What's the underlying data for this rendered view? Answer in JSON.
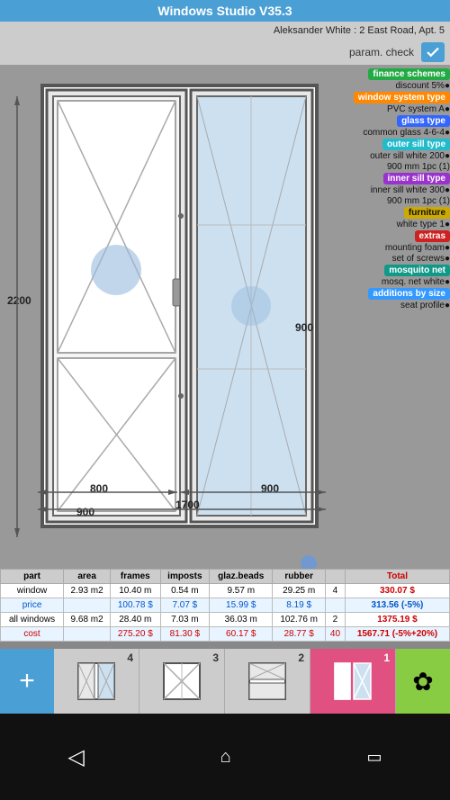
{
  "header": {
    "title": "Windows Studio V35.3",
    "user_info": "Aleksander White : 2 East Road, Apt. 5",
    "param_check": "param. check"
  },
  "labels": [
    {
      "tag": "finance schemes",
      "tag_color": "green-tag",
      "value": ""
    },
    {
      "tag": "",
      "tag_color": "",
      "value": "discount 5%●"
    },
    {
      "tag": "window system type",
      "tag_color": "orange-tag",
      "value": ""
    },
    {
      "tag": "",
      "tag_color": "",
      "value": "PVC system A●"
    },
    {
      "tag": "glass type",
      "tag_color": "blue-tag",
      "value": ""
    },
    {
      "tag": "",
      "tag_color": "",
      "value": "common glass 4-6-4●"
    },
    {
      "tag": "outer sill type",
      "tag_color": "cyan-tag",
      "value": ""
    },
    {
      "tag": "",
      "tag_color": "",
      "value": "outer sill white 200●"
    },
    {
      "tag": "",
      "tag_color": "",
      "value": "900 mm  1pc (1)"
    },
    {
      "tag": "inner sill type",
      "tag_color": "purple-tag",
      "value": ""
    },
    {
      "tag": "",
      "tag_color": "",
      "value": "inner sill white 300●"
    },
    {
      "tag": "",
      "tag_color": "",
      "value": "900 mm  1pc (1)"
    },
    {
      "tag": "furniture",
      "tag_color": "yellow-tag",
      "value": ""
    },
    {
      "tag": "",
      "tag_color": "",
      "value": "white type 1●"
    },
    {
      "tag": "extras",
      "tag_color": "red-tag",
      "value": ""
    },
    {
      "tag": "",
      "tag_color": "",
      "value": "mounting foam●"
    },
    {
      "tag": "",
      "tag_color": "",
      "value": "set of screws●"
    },
    {
      "tag": "mosquito net",
      "tag_color": "teal-tag",
      "value": ""
    },
    {
      "tag": "",
      "tag_color": "",
      "value": "mosq. net white●"
    },
    {
      "tag": "additions by size",
      "tag_color": "additions-tag",
      "value": ""
    },
    {
      "tag": "",
      "tag_color": "",
      "value": "seat profile●"
    }
  ],
  "dimensions": {
    "left": "2200",
    "bottom_left": "800",
    "bottom_mid": "1700",
    "bottom_right": "900",
    "mid_left": "900",
    "right": "900"
  },
  "table": {
    "headers": [
      "part",
      "area",
      "frames",
      "imposts",
      "glaz.beads",
      "rubber",
      "",
      "Total"
    ],
    "rows": [
      {
        "type": "window",
        "part": "window",
        "area": "2.93 m2",
        "frames": "10.40 m",
        "imposts": "0.54 m",
        "glaz_beads": "9.57 m",
        "rubber": "29.25 m",
        "extra": "4",
        "total": "330.07 $"
      },
      {
        "type": "price",
        "part": "price",
        "area": "",
        "frames": "100.78 $",
        "imposts": "7.07 $",
        "glaz_beads": "15.99 $",
        "rubber": "8.19 $",
        "extra": "",
        "total": "313.56 (-5%)"
      },
      {
        "type": "allwindows",
        "part": "all windows",
        "area": "9.68 m2",
        "frames": "28.40 m",
        "imposts": "7.03 m",
        "glaz_beads": "36.03 m",
        "rubber": "102.76 m",
        "extra": "2",
        "total": "1375.19 $"
      },
      {
        "type": "cost",
        "part": "cost",
        "area": "",
        "frames": "275.20 $",
        "imposts": "81.30 $",
        "glaz_beads": "60.17 $",
        "rubber": "28.77 $",
        "extra": "40",
        "total": "1567.71 (-5%+20%)"
      }
    ]
  },
  "tabs": [
    {
      "num": "4",
      "active": false
    },
    {
      "num": "3",
      "active": false
    },
    {
      "num": "2",
      "active": false
    },
    {
      "num": "1",
      "active": true
    }
  ],
  "buttons": {
    "add": "+",
    "flower": "✿"
  },
  "nav": {
    "back": "◁",
    "home": "⌂",
    "recent": "▭"
  }
}
